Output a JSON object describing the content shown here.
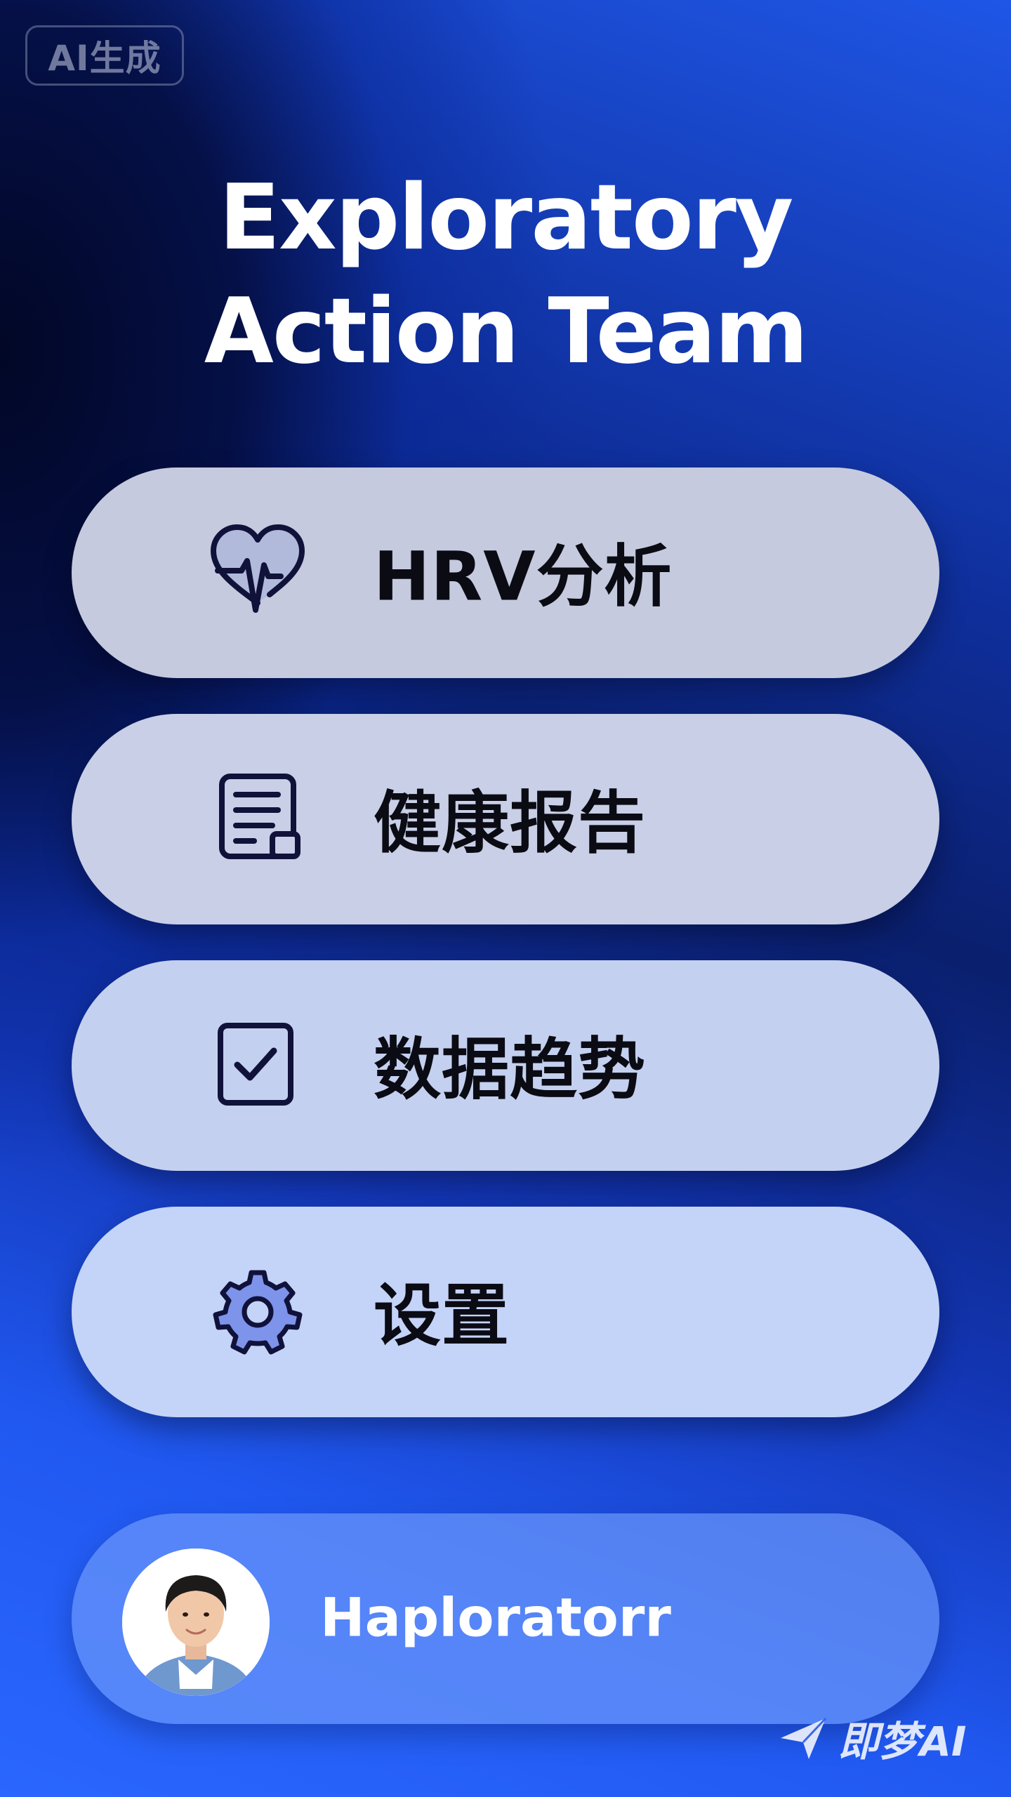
{
  "badge": {
    "label": "AI生成"
  },
  "title": {
    "line1": "Exploratory",
    "line2": "Action Team"
  },
  "menu": {
    "items": [
      {
        "label": "HRV分析",
        "icon": "heart-pulse-icon"
      },
      {
        "label": "健康报告",
        "icon": "document-report-icon"
      },
      {
        "label": "数据趋势",
        "icon": "checkbox-icon"
      },
      {
        "label": "设置",
        "icon": "gear-icon"
      }
    ]
  },
  "profile": {
    "username": "Haploratorr"
  },
  "watermark": {
    "label": "即梦AI"
  },
  "colors": {
    "icon_stroke": "#10123a",
    "gear_fill": "#7e93ea",
    "text_dark": "#0b0b14"
  }
}
